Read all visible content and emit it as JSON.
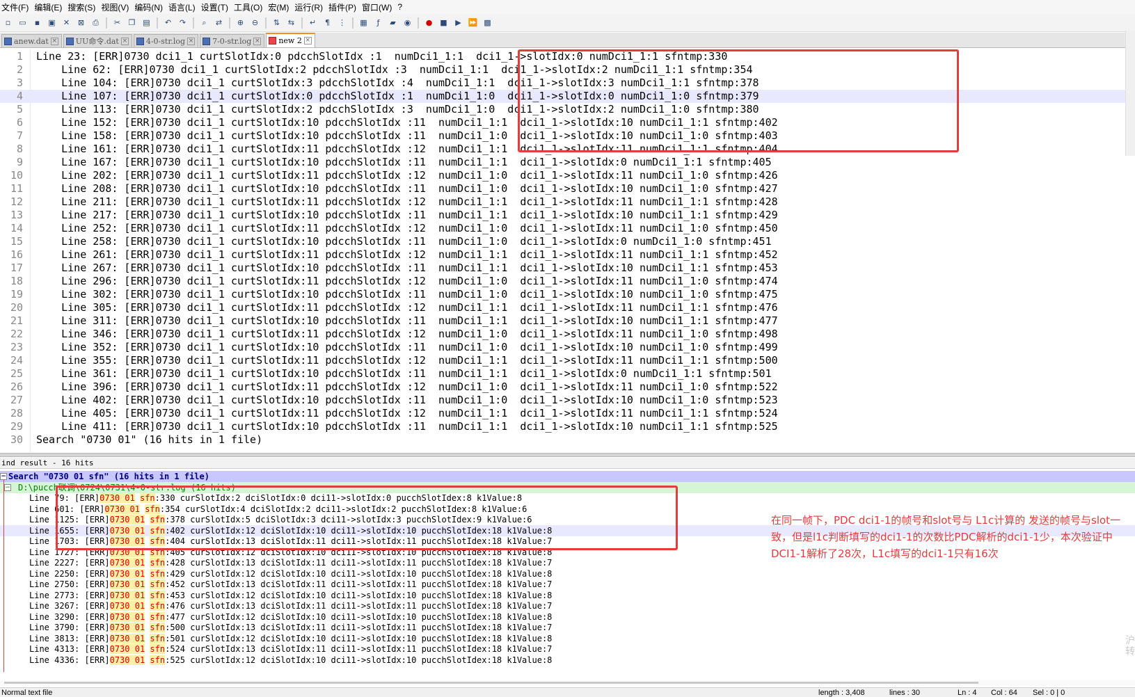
{
  "menu": [
    "文件(F)",
    "编辑(E)",
    "搜索(S)",
    "视图(V)",
    "编码(N)",
    "语言(L)",
    "设置(T)",
    "工具(O)",
    "宏(M)",
    "运行(R)",
    "插件(P)",
    "窗口(W)",
    "?"
  ],
  "toolbar_icons": [
    "new-file-icon",
    "open-file-icon",
    "save-icon",
    "save-all-icon",
    "close-icon",
    "close-all-icon",
    "print-icon",
    "sep",
    "cut-icon",
    "copy-icon",
    "paste-icon",
    "sep",
    "undo-icon",
    "redo-icon",
    "sep",
    "find-icon",
    "replace-icon",
    "sep",
    "zoom-in-icon",
    "zoom-out-icon",
    "sep",
    "sync-v-icon",
    "sync-h-icon",
    "sep",
    "word-wrap-icon",
    "show-all-icon",
    "indent-guide-icon",
    "sep",
    "doc-map-icon",
    "function-list-icon",
    "folder-icon",
    "monitor-icon",
    "sep",
    "record-macro-icon",
    "stop-macro-icon",
    "play-macro-icon",
    "run-macro-multiple-icon",
    "save-macro-icon"
  ],
  "tabs": [
    {
      "label": "anew.dat",
      "active": false
    },
    {
      "label": "UU命令.dat",
      "active": false
    },
    {
      "label": "4-0-str.log",
      "active": false
    },
    {
      "label": "7-0-str.log",
      "active": false
    },
    {
      "label": "new 2",
      "active": true
    }
  ],
  "editor": {
    "current_line": 4,
    "lines": [
      "Line 23: [ERR]0730 dci1_1 curtSlotIdx:0 pdcchSlotIdx :1  numDci1_1:1  dci1_1->slotIdx:0 numDci1_1:1 sfntmp:330",
      "    Line 62: [ERR]0730 dci1_1 curtSlotIdx:2 pdcchSlotIdx :3  numDci1_1:1  dci1_1->slotIdx:2 numDci1_1:1 sfntmp:354",
      "    Line 104: [ERR]0730 dci1_1 curtSlotIdx:3 pdcchSlotIdx :4  numDci1_1:1  dci1_1->slotIdx:3 numDci1_1:1 sfntmp:378",
      "    Line 107: [ERR]0730 dci1_1 curtSlotIdx:0 pdcchSlotIdx :1  numDci1_1:0  dci1_1->slotIdx:0 numDci1_1:0 sfntmp:379",
      "    Line 113: [ERR]0730 dci1_1 curtSlotIdx:2 pdcchSlotIdx :3  numDci1_1:0  dci1_1->slotIdx:2 numDci1_1:0 sfntmp:380",
      "    Line 152: [ERR]0730 dci1_1 curtSlotIdx:10 pdcchSlotIdx :11  numDci1_1:1  dci1_1->slotIdx:10 numDci1_1:1 sfntmp:402",
      "    Line 158: [ERR]0730 dci1_1 curtSlotIdx:10 pdcchSlotIdx :11  numDci1_1:0  dci1_1->slotIdx:10 numDci1_1:0 sfntmp:403",
      "    Line 161: [ERR]0730 dci1_1 curtSlotIdx:11 pdcchSlotIdx :12  numDci1_1:1  dci1_1->slotIdx:11 numDci1_1:1 sfntmp:404",
      "    Line 167: [ERR]0730 dci1_1 curtSlotIdx:10 pdcchSlotIdx :11  numDci1_1:1  dci1_1->slotIdx:0 numDci1_1:1 sfntmp:405",
      "    Line 202: [ERR]0730 dci1_1 curtSlotIdx:11 pdcchSlotIdx :12  numDci1_1:0  dci1_1->slotIdx:11 numDci1_1:0 sfntmp:426",
      "    Line 208: [ERR]0730 dci1_1 curtSlotIdx:10 pdcchSlotIdx :11  numDci1_1:0  dci1_1->slotIdx:10 numDci1_1:0 sfntmp:427",
      "    Line 211: [ERR]0730 dci1_1 curtSlotIdx:11 pdcchSlotIdx :12  numDci1_1:1  dci1_1->slotIdx:11 numDci1_1:1 sfntmp:428",
      "    Line 217: [ERR]0730 dci1_1 curtSlotIdx:10 pdcchSlotIdx :11  numDci1_1:1  dci1_1->slotIdx:10 numDci1_1:1 sfntmp:429",
      "    Line 252: [ERR]0730 dci1_1 curtSlotIdx:11 pdcchSlotIdx :12  numDci1_1:0  dci1_1->slotIdx:11 numDci1_1:0 sfntmp:450",
      "    Line 258: [ERR]0730 dci1_1 curtSlotIdx:10 pdcchSlotIdx :11  numDci1_1:0  dci1_1->slotIdx:0 numDci1_1:0 sfntmp:451",
      "    Line 261: [ERR]0730 dci1_1 curtSlotIdx:11 pdcchSlotIdx :12  numDci1_1:1  dci1_1->slotIdx:11 numDci1_1:1 sfntmp:452",
      "    Line 267: [ERR]0730 dci1_1 curtSlotIdx:10 pdcchSlotIdx :11  numDci1_1:1  dci1_1->slotIdx:10 numDci1_1:1 sfntmp:453",
      "    Line 296: [ERR]0730 dci1_1 curtSlotIdx:11 pdcchSlotIdx :12  numDci1_1:0  dci1_1->slotIdx:11 numDci1_1:0 sfntmp:474",
      "    Line 302: [ERR]0730 dci1_1 curtSlotIdx:10 pdcchSlotIdx :11  numDci1_1:0  dci1_1->slotIdx:10 numDci1_1:0 sfntmp:475",
      "    Line 305: [ERR]0730 dci1_1 curtSlotIdx:11 pdcchSlotIdx :12  numDci1_1:1  dci1_1->slotIdx:11 numDci1_1:1 sfntmp:476",
      "    Line 311: [ERR]0730 dci1_1 curtSlotIdx:10 pdcchSlotIdx :11  numDci1_1:1  dci1_1->slotIdx:10 numDci1_1:1 sfntmp:477",
      "    Line 346: [ERR]0730 dci1_1 curtSlotIdx:11 pdcchSlotIdx :12  numDci1_1:0  dci1_1->slotIdx:11 numDci1_1:0 sfntmp:498",
      "    Line 352: [ERR]0730 dci1_1 curtSlotIdx:10 pdcchSlotIdx :11  numDci1_1:0  dci1_1->slotIdx:10 numDci1_1:0 sfntmp:499",
      "    Line 355: [ERR]0730 dci1_1 curtSlotIdx:11 pdcchSlotIdx :12  numDci1_1:1  dci1_1->slotIdx:11 numDci1_1:1 sfntmp:500",
      "    Line 361: [ERR]0730 dci1_1 curtSlotIdx:10 pdcchSlotIdx :11  numDci1_1:1  dci1_1->slotIdx:0 numDci1_1:1 sfntmp:501",
      "    Line 396: [ERR]0730 dci1_1 curtSlotIdx:11 pdcchSlotIdx :12  numDci1_1:0  dci1_1->slotIdx:11 numDci1_1:0 sfntmp:522",
      "    Line 402: [ERR]0730 dci1_1 curtSlotIdx:10 pdcchSlotIdx :11  numDci1_1:0  dci1_1->slotIdx:10 numDci1_1:0 sfntmp:523",
      "    Line 405: [ERR]0730 dci1_1 curtSlotIdx:11 pdcchSlotIdx :12  numDci1_1:1  dci1_1->slotIdx:11 numDci1_1:1 sfntmp:524",
      "    Line 411: [ERR]0730 dci1_1 curtSlotIdx:10 pdcchSlotIdx :11  numDci1_1:1  dci1_1->slotIdx:10 numDci1_1:1 sfntmp:525",
      "Search \"0730 01\" (16 hits in 1 file)"
    ]
  },
  "find_result": {
    "header": "ind result - 16 hits",
    "search_line": "Search \"0730 01 sfn\" (16 hits in 1 file)",
    "file_line": "D:\\pucch联调\\0724\\0731\\4-0-str.log (16 hits)",
    "rows": [
      {
        "line": "79",
        "rest": "[ERR]",
        "a": "0730 01",
        "b": "sfn",
        "tail": ":330 curSlotIdx:2 dciSlotIdx:0 dci11->slotIdx:0 pucchSlotIdex:8 k1Value:8"
      },
      {
        "line": "601",
        "rest": "[ERR]",
        "a": "0730 01",
        "b": "sfn",
        "tail": ":354 curSlotIdx:4 dciSlotIdx:2 dci11->slotIdx:2 pucchSlotIdex:8 k1Value:6"
      },
      {
        "line": "1125",
        "rest": "[ERR]",
        "a": "0730 01",
        "b": "sfn",
        "tail": ":378 curSlotIdx:5 dciSlotIdx:3 dci11->slotIdx:3 pucchSlotIdex:9 k1Value:6"
      },
      {
        "line": "1655",
        "rest": "[ERR]",
        "a": "0730 01",
        "b": "sfn",
        "tail": ":402 curSlotIdx:12 dciSlotIdx:10 dci11->slotIdx:10 pucchSlotIdex:18 k1Value:8"
      },
      {
        "line": "1703",
        "rest": "[ERR]",
        "a": "0730 01",
        "b": "sfn",
        "tail": ":404 curSlotIdx:13 dciSlotIdx:11 dci11->slotIdx:11 pucchSlotIdex:18 k1Value:7"
      },
      {
        "line": "1727",
        "rest": "[ERR]",
        "a": "0730 01",
        "b": "sfn",
        "tail": ":405 curSlotIdx:12 dciSlotIdx:10 dci11->slotIdx:10 pucchSlotIdex:18 k1Value:8"
      },
      {
        "line": "2227",
        "rest": "[ERR]",
        "a": "0730 01",
        "b": "sfn",
        "tail": ":428 curSlotIdx:13 dciSlotIdx:11 dci11->slotIdx:11 pucchSlotIdex:18 k1Value:7"
      },
      {
        "line": "2250",
        "rest": "[ERR]",
        "a": "0730 01",
        "b": "sfn",
        "tail": ":429 curSlotIdx:12 dciSlotIdx:10 dci11->slotIdx:10 pucchSlotIdex:18 k1Value:8"
      },
      {
        "line": "2750",
        "rest": "[ERR]",
        "a": "0730 01",
        "b": "sfn",
        "tail": ":452 curSlotIdx:13 dciSlotIdx:11 dci11->slotIdx:11 pucchSlotIdex:18 k1Value:7"
      },
      {
        "line": "2773",
        "rest": "[ERR]",
        "a": "0730 01",
        "b": "sfn",
        "tail": ":453 curSlotIdx:12 dciSlotIdx:10 dci11->slotIdx:10 pucchSlotIdex:18 k1Value:8"
      },
      {
        "line": "3267",
        "rest": "[ERR]",
        "a": "0730 01",
        "b": "sfn",
        "tail": ":476 curSlotIdx:13 dciSlotIdx:11 dci11->slotIdx:11 pucchSlotIdex:18 k1Value:7"
      },
      {
        "line": "3290",
        "rest": "[ERR]",
        "a": "0730 01",
        "b": "sfn",
        "tail": ":477 curSlotIdx:12 dciSlotIdx:10 dci11->slotIdx:10 pucchSlotIdex:18 k1Value:8"
      },
      {
        "line": "3790",
        "rest": "[ERR]",
        "a": "0730 01",
        "b": "sfn",
        "tail": ":500 curSlotIdx:13 dciSlotIdx:11 dci11->slotIdx:11 pucchSlotIdex:18 k1Value:7"
      },
      {
        "line": "3813",
        "rest": "[ERR]",
        "a": "0730 01",
        "b": "sfn",
        "tail": ":501 curSlotIdx:12 dciSlotIdx:10 dci11->slotIdx:10 pucchSlotIdex:18 k1Value:8"
      },
      {
        "line": "4313",
        "rest": "[ERR]",
        "a": "0730 01",
        "b": "sfn",
        "tail": ":524 curSlotIdx:13 dciSlotIdx:11 dci11->slotIdx:11 pucchSlotIdex:18 k1Value:7"
      },
      {
        "line": "4336",
        "rest": "[ERR]",
        "a": "0730 01",
        "b": "sfn",
        "tail": ":525 curSlotIdx:12 dciSlotIdx:10 dci11->slotIdx:10 pucchSlotIdex:18 k1Value:8"
      }
    ],
    "selected_row": 3
  },
  "annotation": "在同一帧下，PDC dci1-1的帧号和slot号与 L1c计算的 发送的帧号与slot一致，但是l1c判断填写的dci1-1的次数比PDC解析的dci1-1少，本次验证中DCI1-1解析了28次，L1c填写的dci1-1只有16次",
  "statusbar": {
    "type": "Normal text file",
    "length": "length : 3,408",
    "lines": "lines : 30",
    "ln": "Ln : 4",
    "col": "Col : 64",
    "sel": "Sel : 0 | 0"
  },
  "colors": {
    "highlight_red": "#d40000",
    "search_bg": "#c8c8ff",
    "file_bg": "#d6f5d6",
    "annotation": "#e23c3c",
    "tab_active_accent": "#f28c1e"
  }
}
